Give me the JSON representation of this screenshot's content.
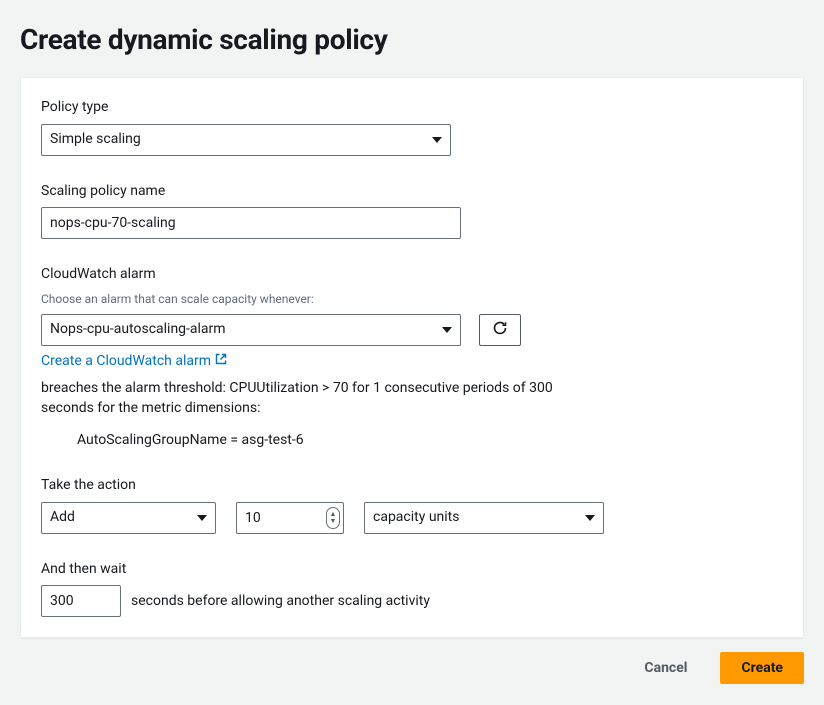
{
  "title": "Create dynamic scaling policy",
  "policyType": {
    "label": "Policy type",
    "value": "Simple scaling"
  },
  "policyName": {
    "label": "Scaling policy name",
    "value": "nops-cpu-70-scaling"
  },
  "alarm": {
    "label": "CloudWatch alarm",
    "hint": "Choose an alarm that can scale capacity whenever:",
    "value": "Nops-cpu-autoscaling-alarm",
    "createLink": "Create a CloudWatch alarm",
    "breachText": "breaches the alarm threshold: CPUUtilization > 70 for 1 consecutive periods of 300 seconds for the metric dimensions:",
    "dimension": "AutoScalingGroupName = asg-test-6"
  },
  "action": {
    "label": "Take the action",
    "op": "Add",
    "amount": "10",
    "unit": "capacity units"
  },
  "cooldown": {
    "label": "And then wait",
    "value": "300",
    "suffix": "seconds before allowing another scaling activity"
  },
  "footer": {
    "cancel": "Cancel",
    "create": "Create"
  }
}
